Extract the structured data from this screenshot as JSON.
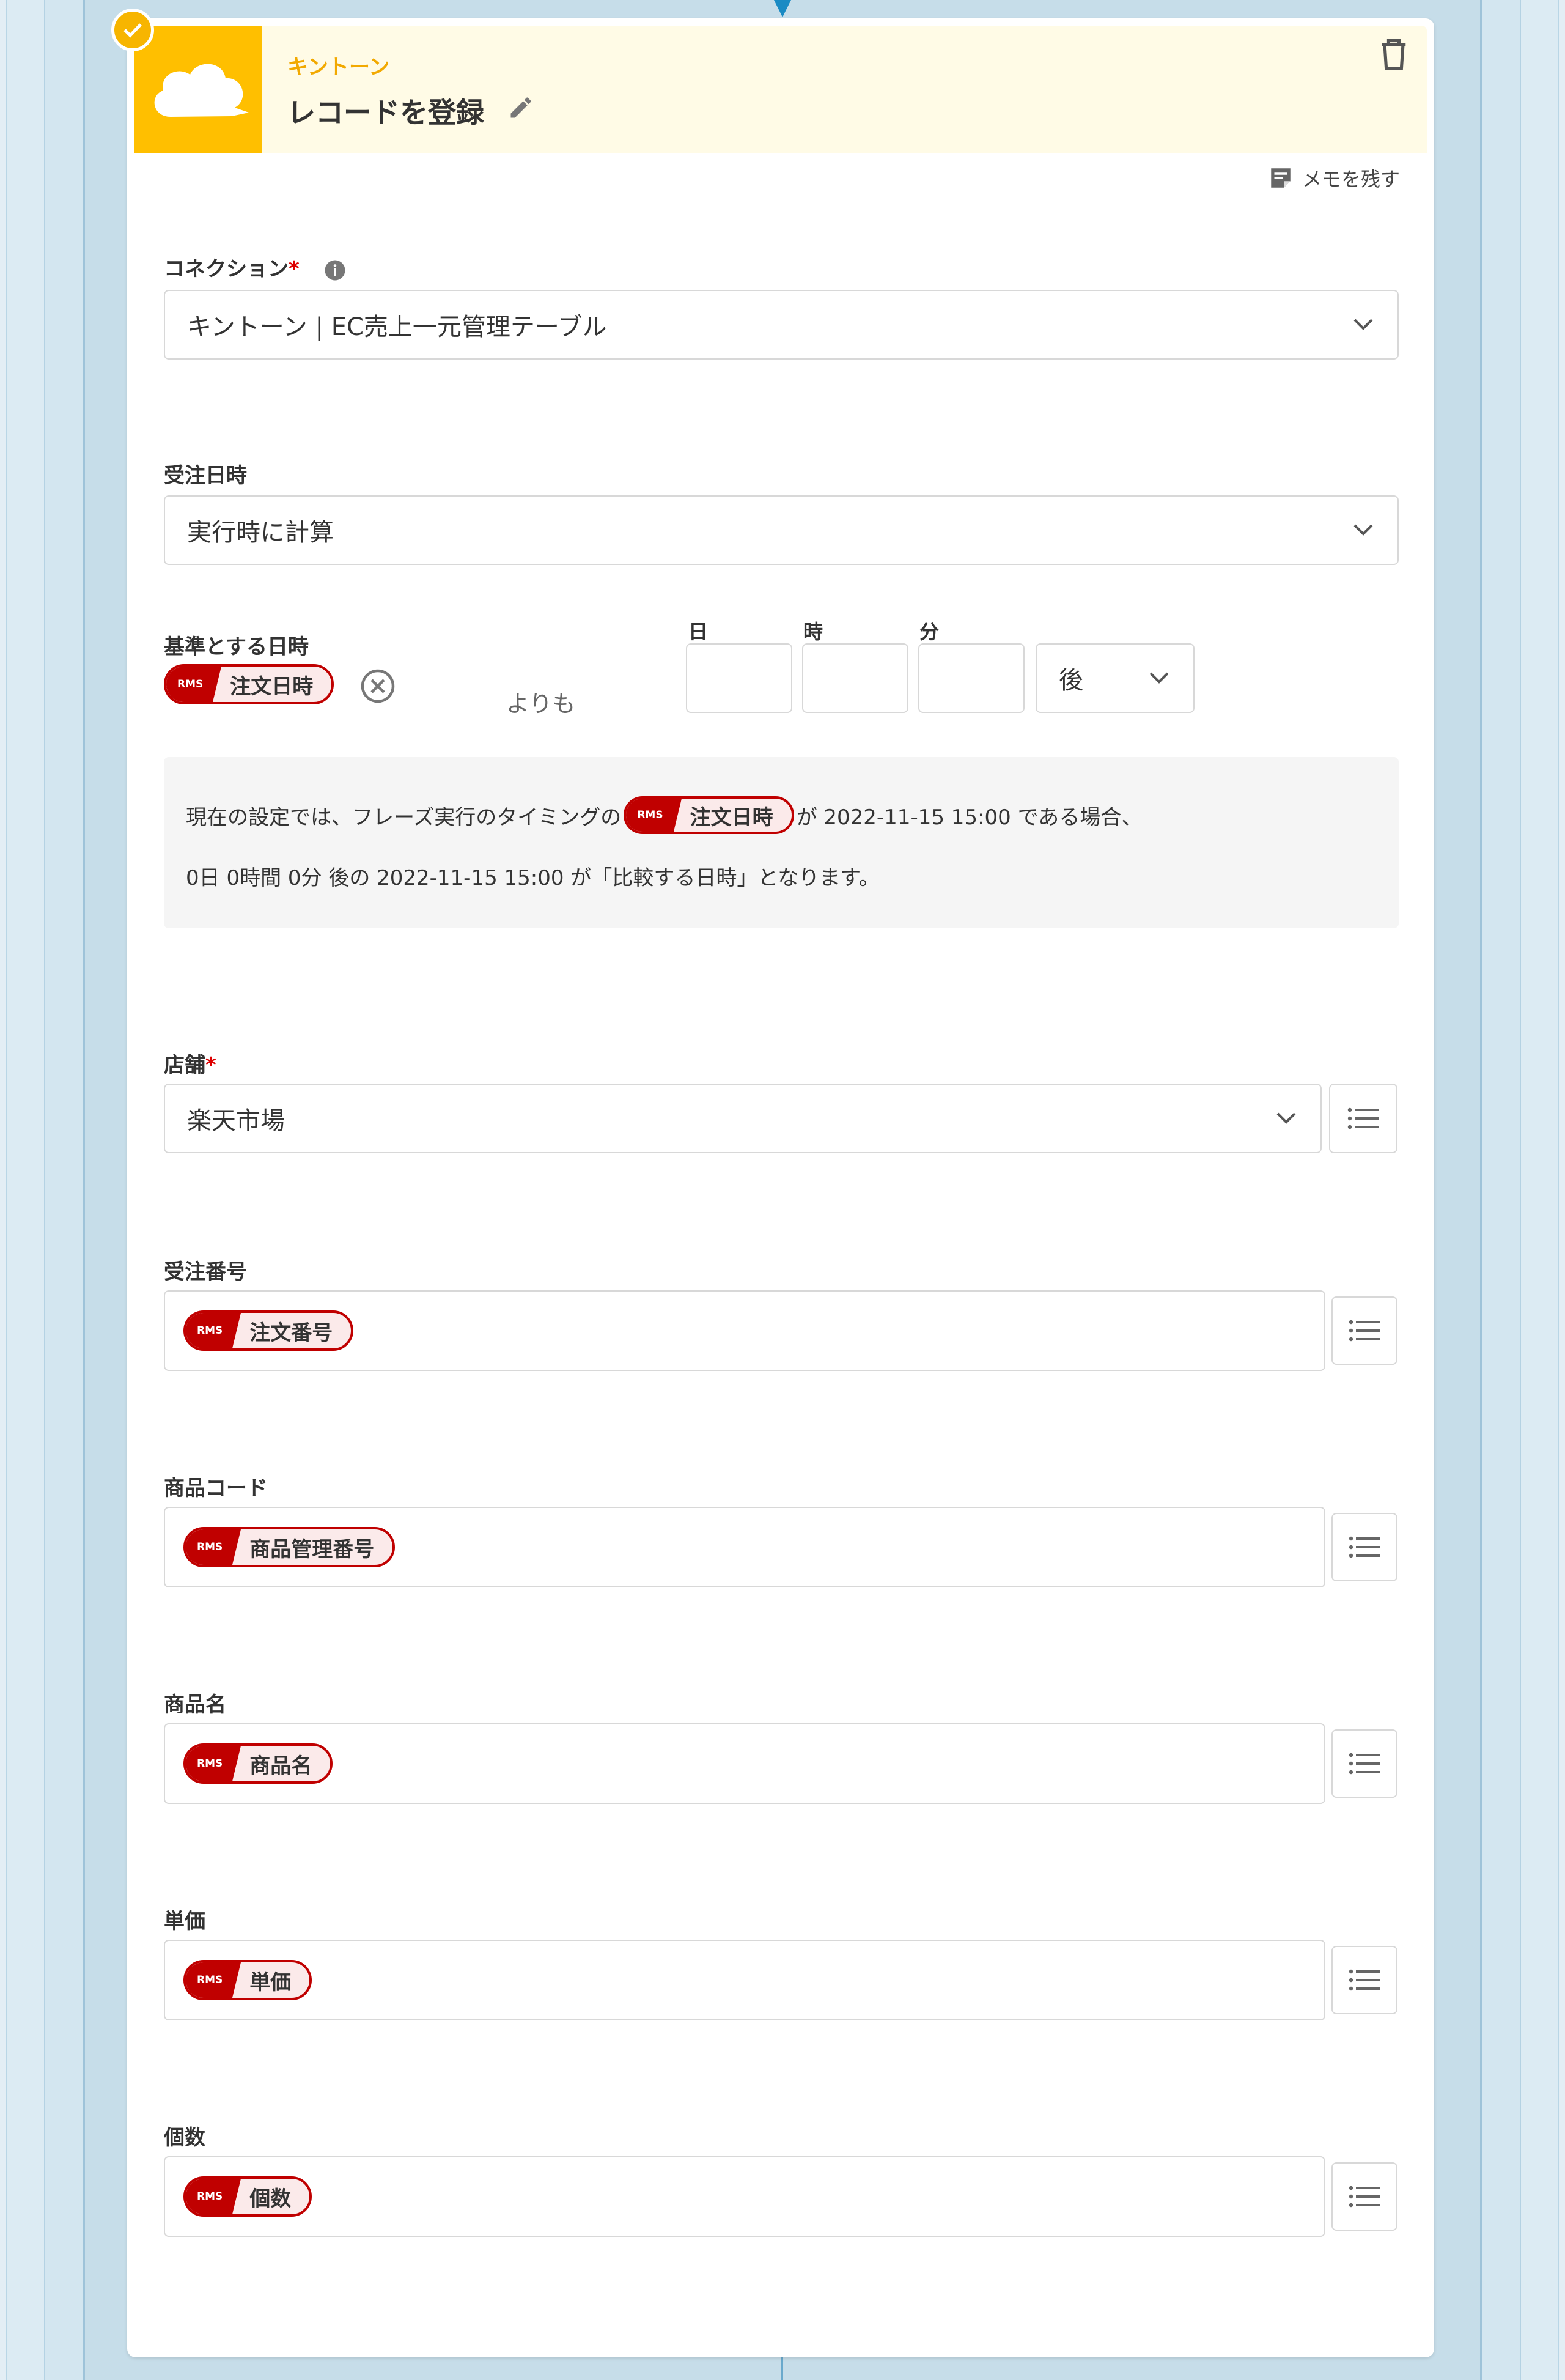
{
  "step": {
    "app_name": "キントーン",
    "title": "レコードを登録",
    "memo_label": "メモを残す"
  },
  "connection": {
    "label": "コネクション",
    "required": "*",
    "value": "キントーン | EC売上一元管理テーブル"
  },
  "order_datetime": {
    "label": "受注日時",
    "mode": "実行時に計算",
    "base_label": "基準とする日時",
    "base_token": {
      "badge": "RMS",
      "name": "注文日時"
    },
    "than": "よりも",
    "day_label": "日",
    "hour_label": "時",
    "minute_label": "分",
    "direction": "後",
    "note_prefix": "現在の設定では、フレーズ実行のタイミングの",
    "note_suffix": "が 2022-11-15 15:00 である場合、",
    "note_line2": "0日 0時間 0分 後の 2022-11-15 15:00 が「比較する日時」となります。"
  },
  "store": {
    "label": "店舗",
    "required": "*",
    "value": "楽天市場"
  },
  "fields": [
    {
      "label": "受注番号",
      "badge": "RMS",
      "token": "注文番号"
    },
    {
      "label": "商品コード",
      "badge": "RMS",
      "token": "商品管理番号"
    },
    {
      "label": "商品名",
      "badge": "RMS",
      "token": "商品名"
    },
    {
      "label": "単価",
      "badge": "RMS",
      "token": "単価"
    },
    {
      "label": "個数",
      "badge": "RMS",
      "token": "個数"
    }
  ],
  "colors": {
    "accent": "#ffbf00",
    "rms_red": "#c00000",
    "header_bg": "#fffbe6"
  },
  "icons": [
    "check-icon",
    "kintone-cloud-icon",
    "pencil-icon",
    "trash-icon",
    "memo-icon",
    "info-icon",
    "chevron-down-icon",
    "clear-circle-icon",
    "list-icon"
  ]
}
